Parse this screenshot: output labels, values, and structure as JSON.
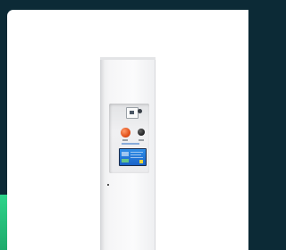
{
  "scene": {
    "subject": "",
    "accent_colors": {
      "background_dark": "#0c2a36",
      "corner_accent": "#2ed48a",
      "cabinet_body": "#f6f6f7",
      "estop_button": "#e2521c",
      "display_screen": "#2f8ee8"
    },
    "icons": [
      "meter-icon",
      "emergency-stop-icon",
      "start-button-icon",
      "display-screen-icon"
    ]
  }
}
